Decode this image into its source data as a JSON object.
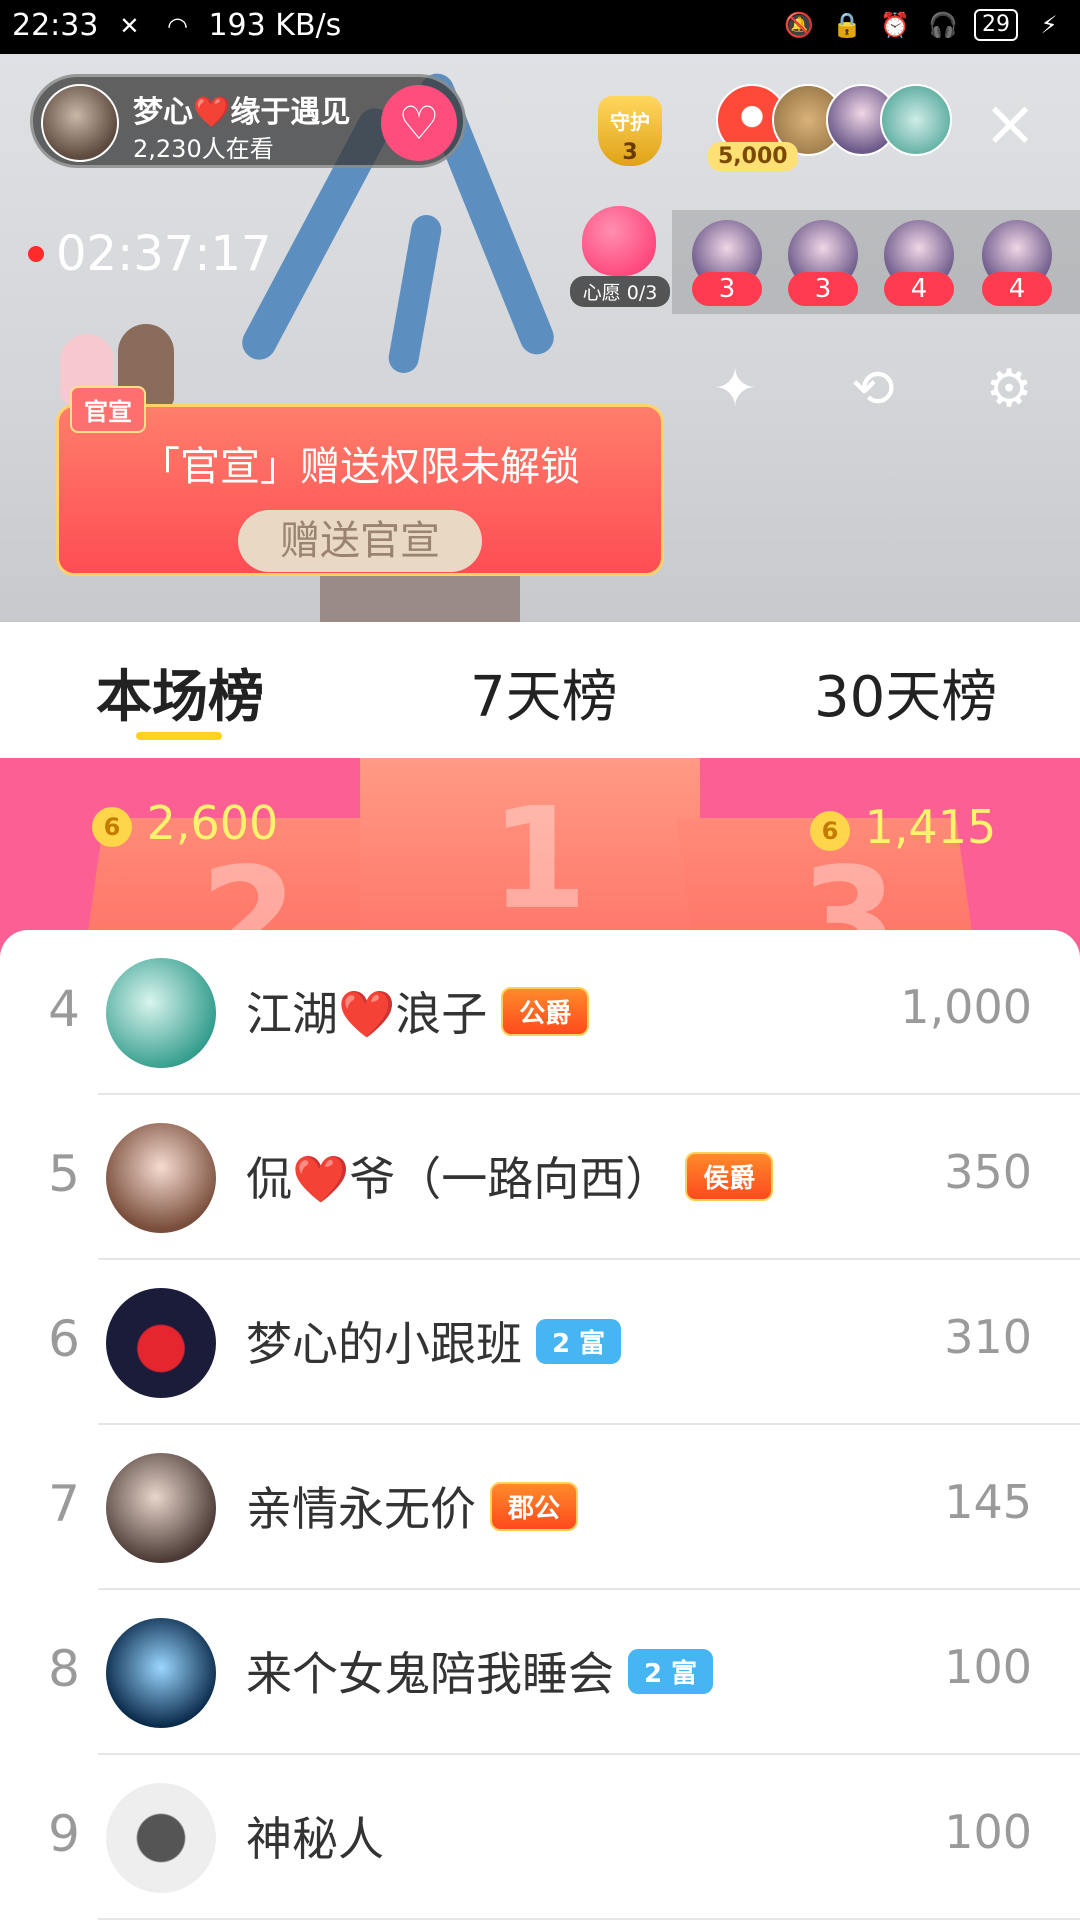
{
  "status_bar": {
    "time": "22:33",
    "network_speed": "193 KB/s",
    "battery": "29",
    "icons": [
      "notification-x-icon",
      "wifi-icon",
      "mute-icon",
      "lock-icon",
      "alarm-icon",
      "headphones-icon",
      "battery-icon",
      "charging-icon"
    ]
  },
  "live": {
    "host_name": "梦心❤️缘于遇见",
    "viewers": "2,230人在看",
    "guard_label": "守护",
    "guard_count": "3",
    "top_fan_coins": "5,000",
    "recording_time": "02:37:17",
    "wish_label": "心愿 0/3",
    "viewer_badges": [
      "3",
      "3",
      "4",
      "4"
    ],
    "promo_tag": "官宣",
    "promo_text": "「官宣」赠送权限未解锁",
    "promo_button": "赠送官宣"
  },
  "tabs": [
    {
      "label": "本场榜",
      "active": true
    },
    {
      "label": "7天榜",
      "active": false
    },
    {
      "label": "30天榜",
      "active": false
    }
  ],
  "podium": {
    "second_value": "2,600",
    "third_value": "1,415",
    "second_label": "2",
    "first_label": "1",
    "third_label": "3",
    "coin_glyph": "6"
  },
  "ranking": [
    {
      "rank": "4",
      "name": "江湖❤️浪子",
      "badge": "公爵",
      "badge_type": "gold",
      "score": "1,000"
    },
    {
      "rank": "5",
      "name": "侃❤️爷（一路向西）",
      "badge": "侯爵",
      "badge_type": "gold",
      "score": "350"
    },
    {
      "rank": "6",
      "name": "梦心的小跟班",
      "badge": "2 富",
      "badge_type": "rich",
      "score": "310"
    },
    {
      "rank": "7",
      "name": "亲情永无价",
      "badge": "郡公",
      "badge_type": "gold",
      "score": "145"
    },
    {
      "rank": "8",
      "name": "来个女鬼陪我睡会",
      "badge": "2 富",
      "badge_type": "rich",
      "score": "100"
    },
    {
      "rank": "9",
      "name": "神秘人",
      "badge": "",
      "badge_type": "",
      "score": "100"
    }
  ],
  "colors": {
    "podium_bg": "#fb5f93",
    "tab_underline": "#ffd21f",
    "accent_pink": "#ff4d7e",
    "coin_gold": "#ffd54a"
  }
}
